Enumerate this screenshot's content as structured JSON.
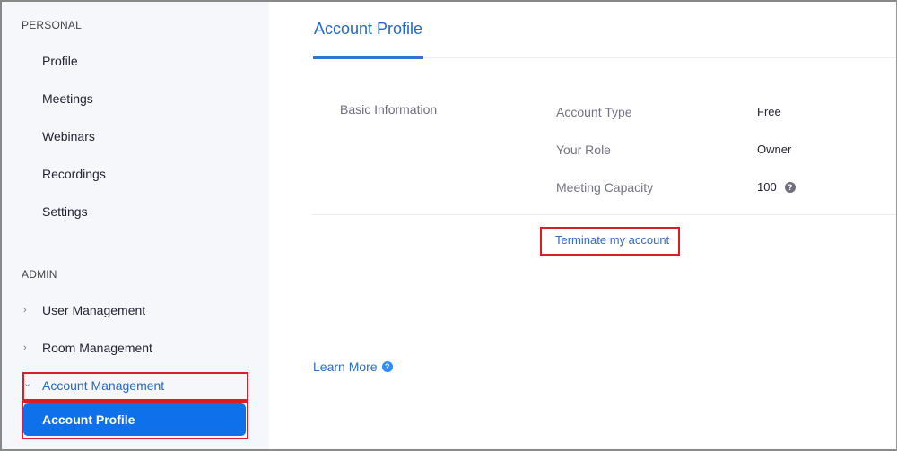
{
  "sidebar": {
    "personal_label": "PERSONAL",
    "personal_items": [
      {
        "label": "Profile"
      },
      {
        "label": "Meetings"
      },
      {
        "label": "Webinars"
      },
      {
        "label": "Recordings"
      },
      {
        "label": "Settings"
      }
    ],
    "admin_label": "ADMIN",
    "admin_items": [
      {
        "label": "User Management",
        "icon": "chevron-right-icon",
        "glyph": "›"
      },
      {
        "label": "Room Management",
        "icon": "chevron-right-icon",
        "glyph": "›"
      },
      {
        "label": "Account Management",
        "icon": "chevron-down-icon",
        "glyph": "⌄"
      }
    ],
    "active_subitem": "Account Profile"
  },
  "main": {
    "title": "Account Profile",
    "section_label": "Basic Information",
    "rows": [
      {
        "label": "Account Type",
        "value": "Free"
      },
      {
        "label": "Your Role",
        "value": "Owner"
      },
      {
        "label": "Meeting Capacity",
        "value": "100",
        "help_icon": "?"
      }
    ],
    "terminate_link": "Terminate my account",
    "learn_more_link": "Learn More",
    "learn_more_icon": "?"
  },
  "colors": {
    "accent": "#0e71eb",
    "link": "#2e6cc6",
    "highlight_box": "#d71f2a"
  }
}
